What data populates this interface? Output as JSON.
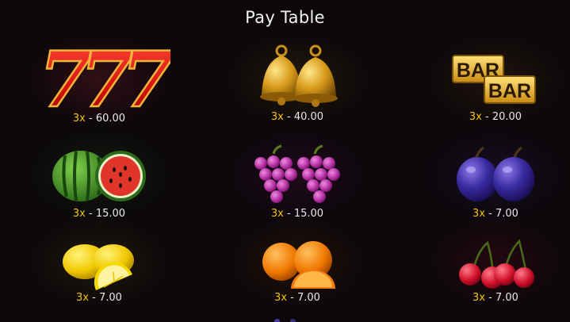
{
  "title": "Pay Table",
  "symbols": [
    {
      "name": "seven",
      "multiplier": "3x",
      "separator": "-",
      "value": "60.00"
    },
    {
      "name": "bell",
      "multiplier": "3x",
      "separator": "-",
      "value": "40.00"
    },
    {
      "name": "bar",
      "multiplier": "3x",
      "separator": "-",
      "value": "20.00",
      "bar_text": "BAR"
    },
    {
      "name": "watermelon",
      "multiplier": "3x",
      "separator": "-",
      "value": "15.00"
    },
    {
      "name": "grapes",
      "multiplier": "3x",
      "separator": "-",
      "value": "15.00"
    },
    {
      "name": "plum",
      "multiplier": "3x",
      "separator": "-",
      "value": "7.00"
    },
    {
      "name": "lemon",
      "multiplier": "3x",
      "separator": "-",
      "value": "7.00"
    },
    {
      "name": "orange",
      "multiplier": "3x",
      "separator": "-",
      "value": "7.00"
    },
    {
      "name": "cherry",
      "multiplier": "3x",
      "separator": "-",
      "value": "7.00"
    }
  ],
  "seven_glyph": "7",
  "pagination": {
    "pages": 2,
    "current": 1
  },
  "colors": {
    "multiplier": "#f5c400",
    "value": "#e8e8e8",
    "title": "#f2f2f2",
    "dot": "#3a2e7a"
  }
}
